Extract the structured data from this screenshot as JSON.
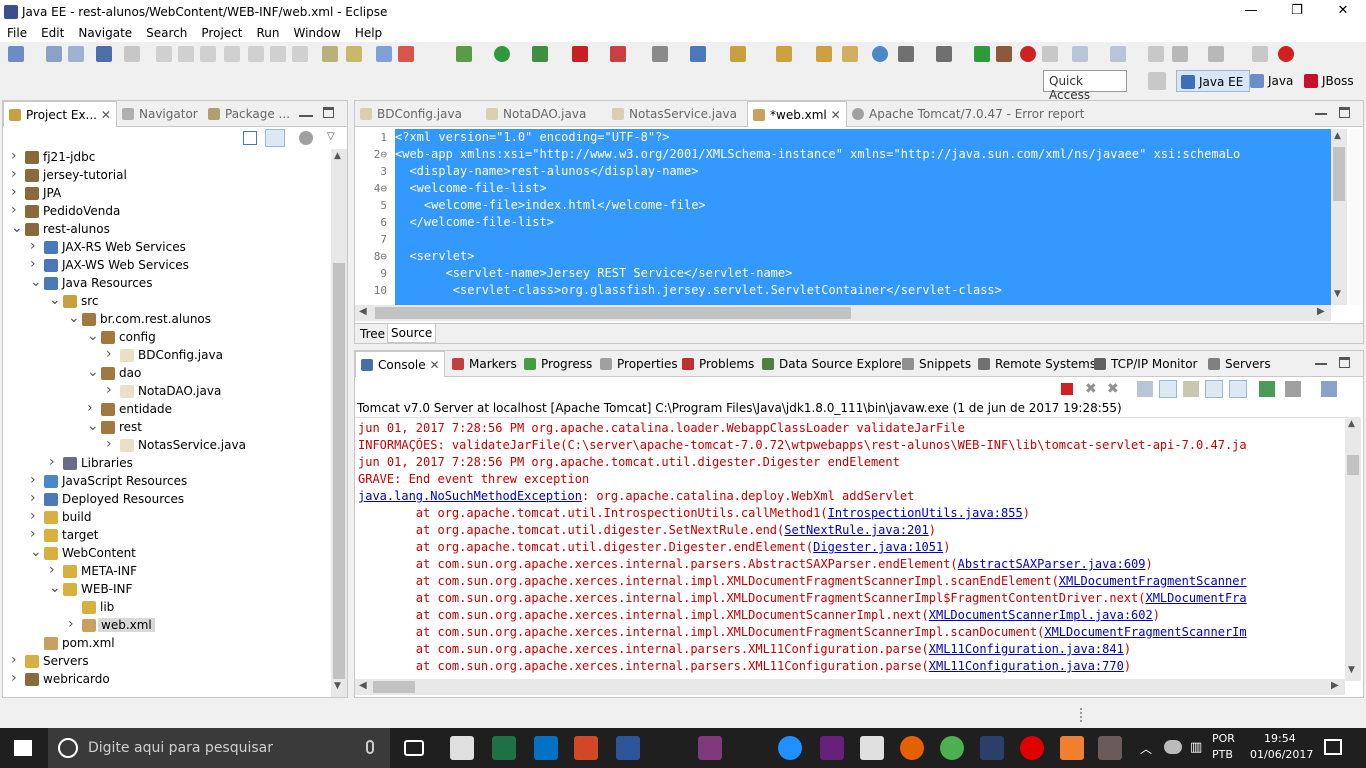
{
  "window": {
    "title": "Java EE - rest-alunos/WebContent/WEB-INF/web.xml - Eclipse",
    "minimize": "—",
    "restore": "❐",
    "close": "✕"
  },
  "menu": [
    "File",
    "Edit",
    "Navigate",
    "Search",
    "Project",
    "Run",
    "Window",
    "Help"
  ],
  "quick_access": {
    "placeholder": "Quick Access"
  },
  "perspectives": [
    {
      "label": "Java EE",
      "color": "#3b6fb6"
    },
    {
      "label": "Java",
      "color": "#6a8fc7"
    },
    {
      "label": "JBoss",
      "color": "#c8102e"
    }
  ],
  "left_tabs": [
    "Project Ex...",
    "Navigator",
    "Package ..."
  ],
  "tree": [
    {
      "label": "fj21-jdbc",
      "depth": 0,
      "tw": ">",
      "icon": "project-icon"
    },
    {
      "label": "jersey-tutorial",
      "depth": 0,
      "tw": ">",
      "icon": "project-icon"
    },
    {
      "label": "JPA",
      "depth": 0,
      "tw": ">",
      "icon": "project-icon"
    },
    {
      "label": "PedidoVenda",
      "depth": 0,
      "tw": ">",
      "icon": "project-icon"
    },
    {
      "label": "rest-alunos",
      "depth": 0,
      "tw": "v",
      "icon": "project-icon"
    },
    {
      "label": "JAX-RS Web Services",
      "depth": 1,
      "tw": ">",
      "icon": "services-icon"
    },
    {
      "label": "JAX-WS Web Services",
      "depth": 1,
      "tw": ">",
      "icon": "services-icon"
    },
    {
      "label": "Java Resources",
      "depth": 1,
      "tw": "v",
      "icon": "resources-icon"
    },
    {
      "label": "src",
      "depth": 2,
      "tw": "v",
      "icon": "source-folder-icon"
    },
    {
      "label": "br.com.rest.alunos",
      "depth": 3,
      "tw": "v",
      "icon": "package-icon"
    },
    {
      "label": "config",
      "depth": 4,
      "tw": "v",
      "icon": "package-icon"
    },
    {
      "label": "BDConfig.java",
      "depth": 5,
      "tw": ">",
      "icon": "java-file-icon"
    },
    {
      "label": "dao",
      "depth": 4,
      "tw": "v",
      "icon": "package-icon"
    },
    {
      "label": "NotaDAO.java",
      "depth": 5,
      "tw": ">",
      "icon": "java-file-icon"
    },
    {
      "label": "entidade",
      "depth": 4,
      "tw": ">",
      "icon": "package-icon"
    },
    {
      "label": "rest",
      "depth": 4,
      "tw": "v",
      "icon": "package-icon"
    },
    {
      "label": "NotasService.java",
      "depth": 5,
      "tw": ">",
      "icon": "java-file-icon"
    },
    {
      "label": "Libraries",
      "depth": 2,
      "tw": ">",
      "icon": "libraries-icon"
    },
    {
      "label": "JavaScript Resources",
      "depth": 1,
      "tw": ">",
      "icon": "js-icon"
    },
    {
      "label": "Deployed Resources",
      "depth": 1,
      "tw": ">",
      "icon": "deployed-icon"
    },
    {
      "label": "build",
      "depth": 1,
      "tw": ">",
      "icon": "folder-icon"
    },
    {
      "label": "target",
      "depth": 1,
      "tw": ">",
      "icon": "folder-icon"
    },
    {
      "label": "WebContent",
      "depth": 1,
      "tw": "v",
      "icon": "folder-icon"
    },
    {
      "label": "META-INF",
      "depth": 2,
      "tw": ">",
      "icon": "folder-icon"
    },
    {
      "label": "WEB-INF",
      "depth": 2,
      "tw": "v",
      "icon": "folder-icon"
    },
    {
      "label": "lib",
      "depth": 3,
      "tw": "",
      "icon": "folder-icon"
    },
    {
      "label": "web.xml",
      "depth": 3,
      "tw": ">",
      "icon": "xml-file-icon"
    },
    {
      "label": "pom.xml",
      "depth": 1,
      "tw": "",
      "icon": "xml-file-icon"
    },
    {
      "label": "Servers",
      "depth": 0,
      "tw": ">",
      "icon": "folder-icon"
    },
    {
      "label": "webricardo",
      "depth": 0,
      "tw": ">",
      "icon": "project-icon"
    }
  ],
  "editor_tabs": [
    "BDConfig.java",
    "NotaDAO.java",
    "NotasService.java",
    "*web.xml",
    "Apache Tomcat/7.0.47 - Error report"
  ],
  "editor_lines": [
    {
      "n": "1",
      "text": "<?xml version=\"1.0\" encoding=\"UTF-8\"?>"
    },
    {
      "n": "2⊖",
      "text": "<web-app xmlns:xsi=\"http://www.w3.org/2001/XMLSchema-instance\" xmlns=\"http://java.sun.com/xml/ns/javaee\" xsi:schemaLo"
    },
    {
      "n": "3",
      "text": "  <display-name>rest-alunos</display-name>"
    },
    {
      "n": "4⊖",
      "text": "  <welcome-file-list>"
    },
    {
      "n": "5",
      "text": "    <welcome-file>index.html</welcome-file>"
    },
    {
      "n": "6",
      "text": "  </welcome-file-list>"
    },
    {
      "n": "7",
      "text": ""
    },
    {
      "n": "8⊖",
      "text": "  <servlet>"
    },
    {
      "n": "9",
      "text": "       <servlet-name>Jersey REST Service</servlet-name>"
    },
    {
      "n": "10",
      "text": "        <servlet-class>org.glassfish.jersey.servlet.ServletContainer</servlet-class>"
    }
  ],
  "editor_bottom_tabs": [
    "Tree",
    "Source"
  ],
  "console_tabs": [
    "Console",
    "Markers",
    "Progress",
    "Properties",
    "Problems",
    "Data Source Explorer",
    "Snippets",
    "Remote Systems",
    "TCP/IP Monitor",
    "Servers"
  ],
  "console_header": "Tomcat v7.0 Server at localhost [Apache Tomcat] C:\\Program Files\\Java\\jdk1.8.0_111\\bin\\javaw.exe (1 de jun de 2017 19:28:55)",
  "console_lines": [
    {
      "pre": "jun 01, 2017 7:28:56 PM org.apache.catalina.loader.WebappClassLoader validateJarFile",
      "link": "",
      "post": ""
    },
    {
      "pre": "INFORMAÇÕES: validateJarFile(C:\\server\\apache-tomcat-7.0.72\\wtpwebapps\\rest-alunos\\WEB-INF\\lib\\tomcat-servlet-api-7.0.47.ja",
      "link": "",
      "post": ""
    },
    {
      "pre": "jun 01, 2017 7:28:56 PM org.apache.tomcat.util.digester.Digester endElement",
      "link": "",
      "post": ""
    },
    {
      "pre": "GRAVE: End event threw exception",
      "link": "",
      "post": ""
    },
    {
      "pre": "",
      "link": "java.lang.NoSuchMethodException",
      "post": ": org.apache.catalina.deploy.WebXml addServlet"
    },
    {
      "pre": "        at org.apache.tomcat.util.IntrospectionUtils.callMethod1(",
      "link": "IntrospectionUtils.java:855",
      "post": ")"
    },
    {
      "pre": "        at org.apache.tomcat.util.digester.SetNextRule.end(",
      "link": "SetNextRule.java:201",
      "post": ")"
    },
    {
      "pre": "        at org.apache.tomcat.util.digester.Digester.endElement(",
      "link": "Digester.java:1051",
      "post": ")"
    },
    {
      "pre": "        at com.sun.org.apache.xerces.internal.parsers.AbstractSAXParser.endElement(",
      "link": "AbstractSAXParser.java:609",
      "post": ")"
    },
    {
      "pre": "        at com.sun.org.apache.xerces.internal.impl.XMLDocumentFragmentScannerImpl.scanEndElement(",
      "link": "XMLDocumentFragmentScanner",
      "post": ""
    },
    {
      "pre": "        at com.sun.org.apache.xerces.internal.impl.XMLDocumentFragmentScannerImpl$FragmentContentDriver.next(",
      "link": "XMLDocumentFra",
      "post": ""
    },
    {
      "pre": "        at com.sun.org.apache.xerces.internal.impl.XMLDocumentScannerImpl.next(",
      "link": "XMLDocumentScannerImpl.java:602",
      "post": ")"
    },
    {
      "pre": "        at com.sun.org.apache.xerces.internal.impl.XMLDocumentFragmentScannerImpl.scanDocument(",
      "link": "XMLDocumentFragmentScannerIm",
      "post": ""
    },
    {
      "pre": "        at com.sun.org.apache.xerces.internal.parsers.XML11Configuration.parse(",
      "link": "XML11Configuration.java:841",
      "post": ")"
    },
    {
      "pre": "        at com.sun.org.apache.xerces.internal.parsers.XML11Configuration.parse(",
      "link": "XML11Configuration.java:770",
      "post": ")"
    }
  ],
  "taskbar": {
    "search_placeholder": "Digite aqui para pesquisar",
    "lang_top": "POR",
    "lang_bottom": "PTB",
    "time": "19:54",
    "date": "01/06/2017"
  },
  "colors": {
    "selection": "#3399ff",
    "console_red": "#c80000",
    "link": "#0000c8",
    "taskbar": "#1f1f1f"
  }
}
